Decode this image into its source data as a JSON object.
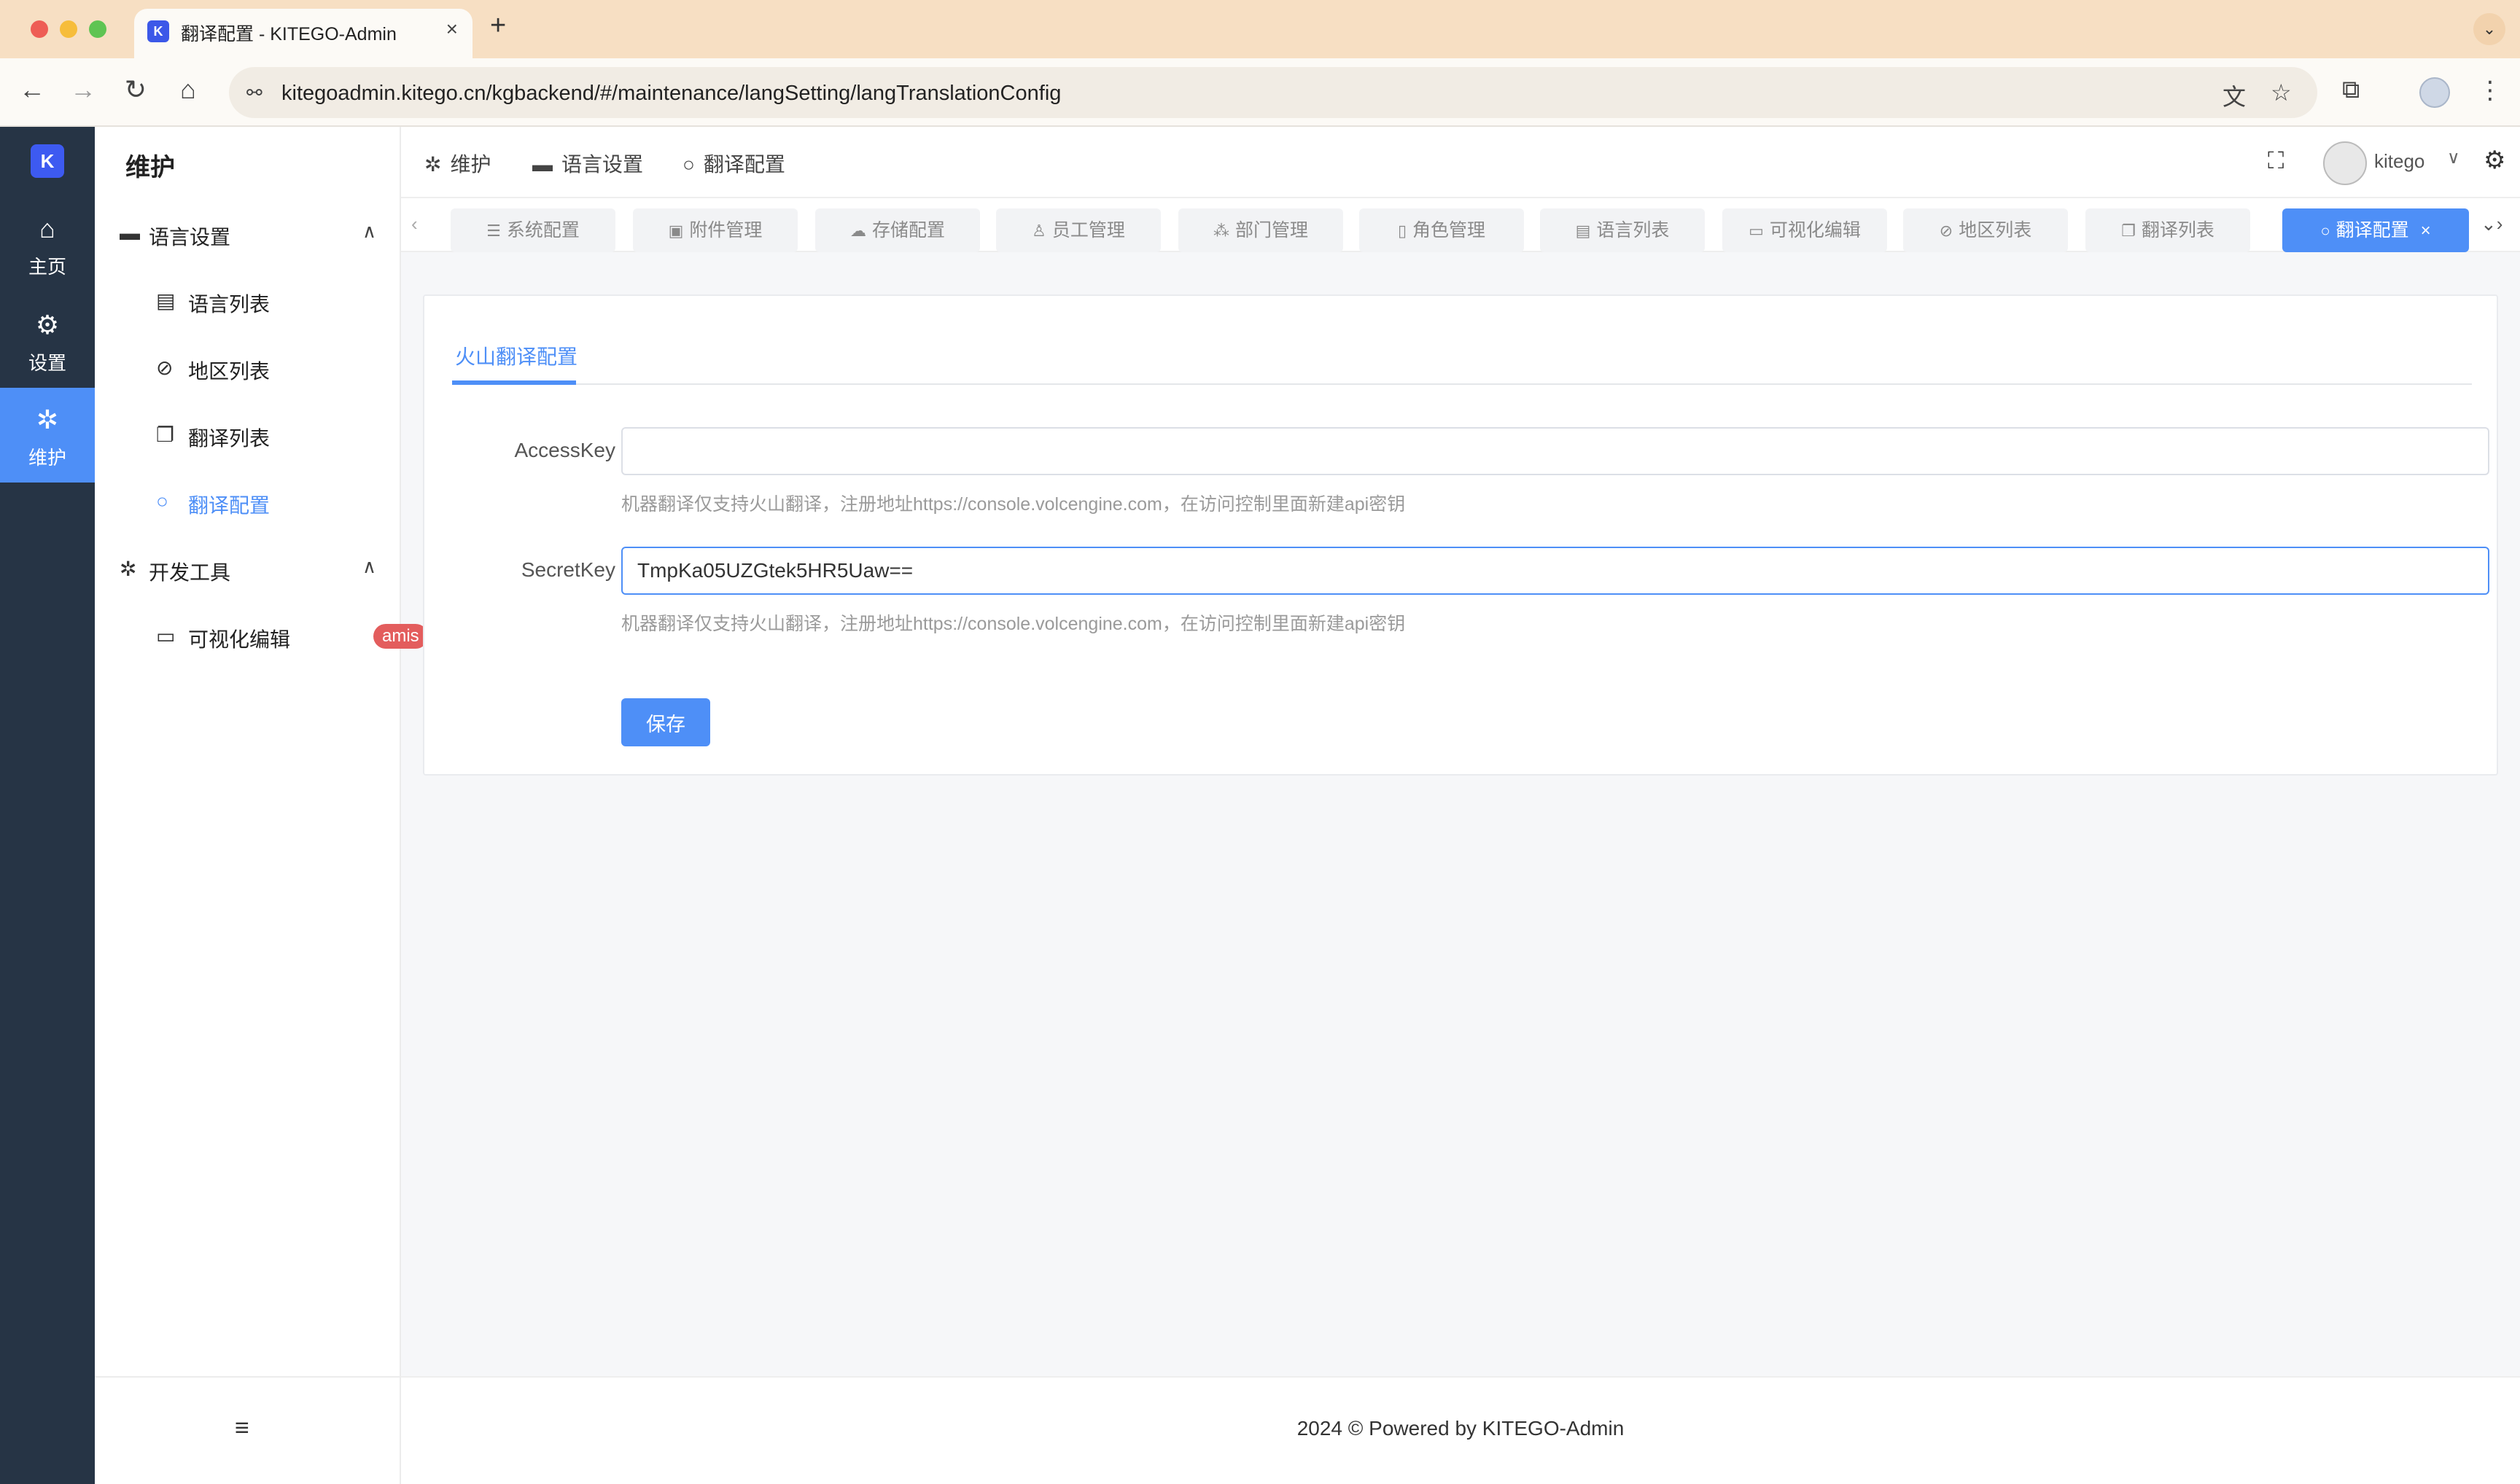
{
  "browser": {
    "tab_title": "翻译配置 - KITEGO-Admin",
    "tab_close": "×",
    "new_tab": "+",
    "url": "kitegoadmin.kitego.cn/kgbackend/#/maintenance/langSetting/langTranslationConfig"
  },
  "rail": {
    "logo": "K",
    "items": [
      {
        "label": "主页",
        "icon": "⌂"
      },
      {
        "label": "设置",
        "icon": "⚙"
      },
      {
        "label": "维护",
        "icon": "✲"
      }
    ]
  },
  "sidebar": {
    "module_title": "维护",
    "groups": [
      {
        "label": "语言设置",
        "icon": "▬",
        "caret": "∧"
      },
      {
        "label": "开发工具",
        "icon": "✲",
        "caret": "∧"
      }
    ],
    "items": [
      {
        "label": "语言列表",
        "icon": "▤"
      },
      {
        "label": "地区列表",
        "icon": "⊘"
      },
      {
        "label": "翻译列表",
        "icon": "❐"
      },
      {
        "label": "翻译配置",
        "icon": "○"
      },
      {
        "label": "可视化编辑",
        "icon": "▭",
        "badge": "amis"
      }
    ],
    "collapse_icon": "≡"
  },
  "topbar": {
    "breadcrumb": [
      {
        "label": "维护",
        "icon": "✲"
      },
      {
        "label": "语言设置",
        "icon": "▬"
      },
      {
        "label": "翻译配置",
        "icon": "○"
      }
    ],
    "user_name": "kitego",
    "user_caret": "∨"
  },
  "tags": [
    {
      "label": "系统配置",
      "icon": "☰"
    },
    {
      "label": "附件管理",
      "icon": "▣"
    },
    {
      "label": "存储配置",
      "icon": "☁"
    },
    {
      "label": "员工管理",
      "icon": "♙"
    },
    {
      "label": "部门管理",
      "icon": "⁂"
    },
    {
      "label": "角色管理",
      "icon": "▯"
    },
    {
      "label": "语言列表",
      "icon": "▤"
    },
    {
      "label": "可视化编辑",
      "icon": "▭"
    },
    {
      "label": "地区列表",
      "icon": "⊘"
    },
    {
      "label": "翻译列表",
      "icon": "❐"
    },
    {
      "label": "翻译配置",
      "icon": "○",
      "active": true,
      "close": "×"
    }
  ],
  "panel": {
    "tab": "火山翻译配置",
    "access_key_label": "AccessKey",
    "access_key_value": "",
    "secret_key_label": "SecretKey",
    "secret_key_value": "TmpKa05UZGtek5HR5Uaw==",
    "hint": "机器翻译仅支持火山翻译，注册地址https://console.volcengine.com，在访问控制里面新建api密钥",
    "save_label": "保存"
  },
  "footer": {
    "text": "2024 © Powered by  KITEGO-Admin"
  },
  "colors": {
    "accent": "#4e8ff7",
    "rail_bg": "#263445",
    "badge": "#e35d5d",
    "chrome": "#f7dfc3"
  }
}
